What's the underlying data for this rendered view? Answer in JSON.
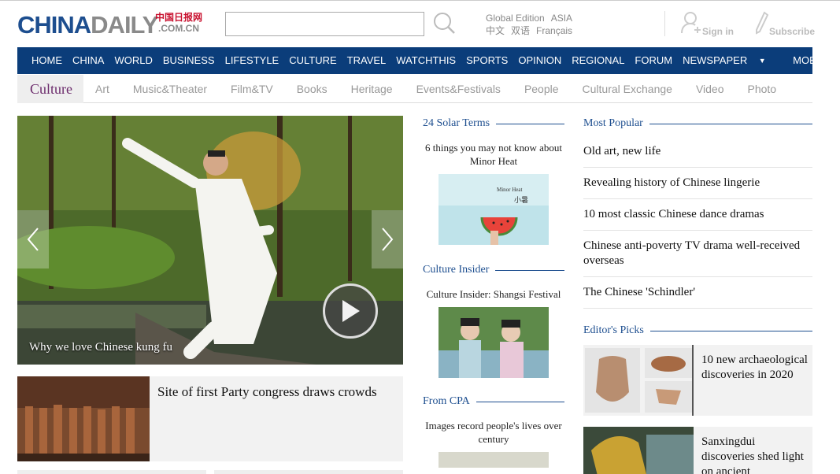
{
  "header": {
    "logo_china": "CHINA",
    "logo_daily": "DAILY",
    "logo_cn": "中国日报网",
    "logo_domain": ".COM.CN",
    "search": {
      "placeholder": ""
    },
    "editions_row1": [
      "Global Edition",
      "ASIA"
    ],
    "editions_row2": [
      "中文",
      "双语",
      "Français"
    ],
    "signin_label": "Sign in",
    "subscribe_label": "Subscribe"
  },
  "main_nav": {
    "items": [
      "HOME",
      "CHINA",
      "WORLD",
      "BUSINESS",
      "LIFESTYLE",
      "CULTURE",
      "TRAVEL",
      "WATCHTHIS",
      "SPORTS",
      "OPINION",
      "REGIONAL",
      "FORUM",
      "NEWSPAPER"
    ],
    "mobile": "MOBILE"
  },
  "sub_nav": {
    "current": "Culture",
    "tabs": [
      "Art",
      "Music&Theater",
      "Film&TV",
      "Books",
      "Heritage",
      "Events&Festivals",
      "People",
      "Cultural Exchange",
      "Video",
      "Photo"
    ]
  },
  "hero": {
    "caption": "Why we love Chinese kung fu"
  },
  "story": {
    "title": "Site of first Party congress draws crowds"
  },
  "middle": {
    "sections": [
      {
        "heading": "24 Solar Terms",
        "item": "6 things you may not know about Minor Heat",
        "img_text_en": "Minor Heat",
        "img_text_cn": "小暑"
      },
      {
        "heading": "Culture Insider",
        "item": "Culture Insider: Shangsi Festival"
      },
      {
        "heading": "From CPA",
        "item": "Images record people's lives over century"
      }
    ]
  },
  "right": {
    "popular_heading": "Most Popular",
    "popular": [
      "Old art, new life",
      "Revealing history of Chinese lingerie",
      "10 most classic Chinese dance dramas",
      "Chinese anti-poverty TV drama well-received overseas",
      "The Chinese 'Schindler'"
    ],
    "picks_heading": "Editor's Picks",
    "picks": [
      "10 new archaeological discoveries in 2020",
      "Sanxingdui discoveries shed light on ancient"
    ]
  },
  "colors": {
    "nav_bg": "#0b3d7a",
    "section_blue": "#1d4e8f",
    "culture_purple": "#6b2a6b"
  }
}
